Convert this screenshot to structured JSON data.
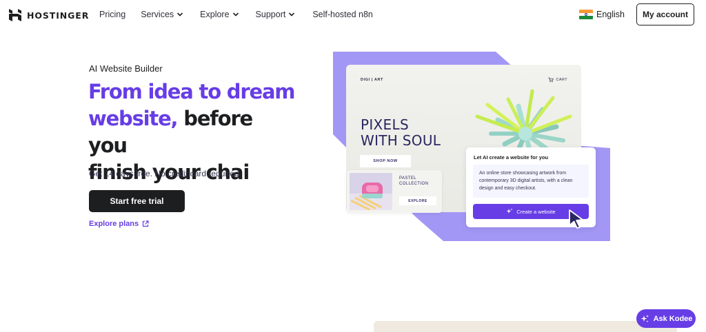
{
  "nav": {
    "brand": "HOSTINGER",
    "links": [
      {
        "label": "Pricing",
        "dropdown": false
      },
      {
        "label": "Services",
        "dropdown": true
      },
      {
        "label": "Explore",
        "dropdown": true
      },
      {
        "label": "Support",
        "dropdown": true
      },
      {
        "label": "Self-hosted n8n",
        "dropdown": false
      }
    ],
    "language": "English",
    "account_button": "My account"
  },
  "hero": {
    "eyebrow": "AI Website Builder",
    "headline_highlight_1": "From idea to dream",
    "headline_highlight_2": "website,",
    "headline_rest_1": " before you",
    "headline_rest_2": "finish your chai",
    "subtext": "Get 14 days free. No credit card required.",
    "cta": "Start free trial",
    "explore_link": "Explore plans"
  },
  "illustration": {
    "store_brand": "DIGI | ART",
    "cart_label": "CART",
    "store_headline_1": "PIXELS",
    "store_headline_2": "WITH SOUL",
    "shop_button": "SHOP NOW",
    "collection_title_1": "PASTEL",
    "collection_title_2": "COLLECTION",
    "collection_button": "EXPLORE",
    "ai_card_title": "Let AI create a website for you",
    "ai_prompt": "An online store showcasing artwork from contemporary 3D digital artists, with a clean design and easy checkout.",
    "ai_button": "Create a website"
  },
  "chat": {
    "label": "Ask Kodee"
  },
  "colors": {
    "accent": "#673de6",
    "illustration_purple": "#a397f5",
    "text_dark": "#1d1e20"
  },
  "icons": {
    "logo": "hostinger-logo-icon",
    "chevron": "chevron-down-icon",
    "flag": "india-flag-icon",
    "external": "external-link-icon",
    "cart": "cart-icon",
    "sparkle": "sparkle-icon",
    "cursor": "mouse-cursor-icon",
    "kodee": "kodee-sparkle-icon"
  }
}
